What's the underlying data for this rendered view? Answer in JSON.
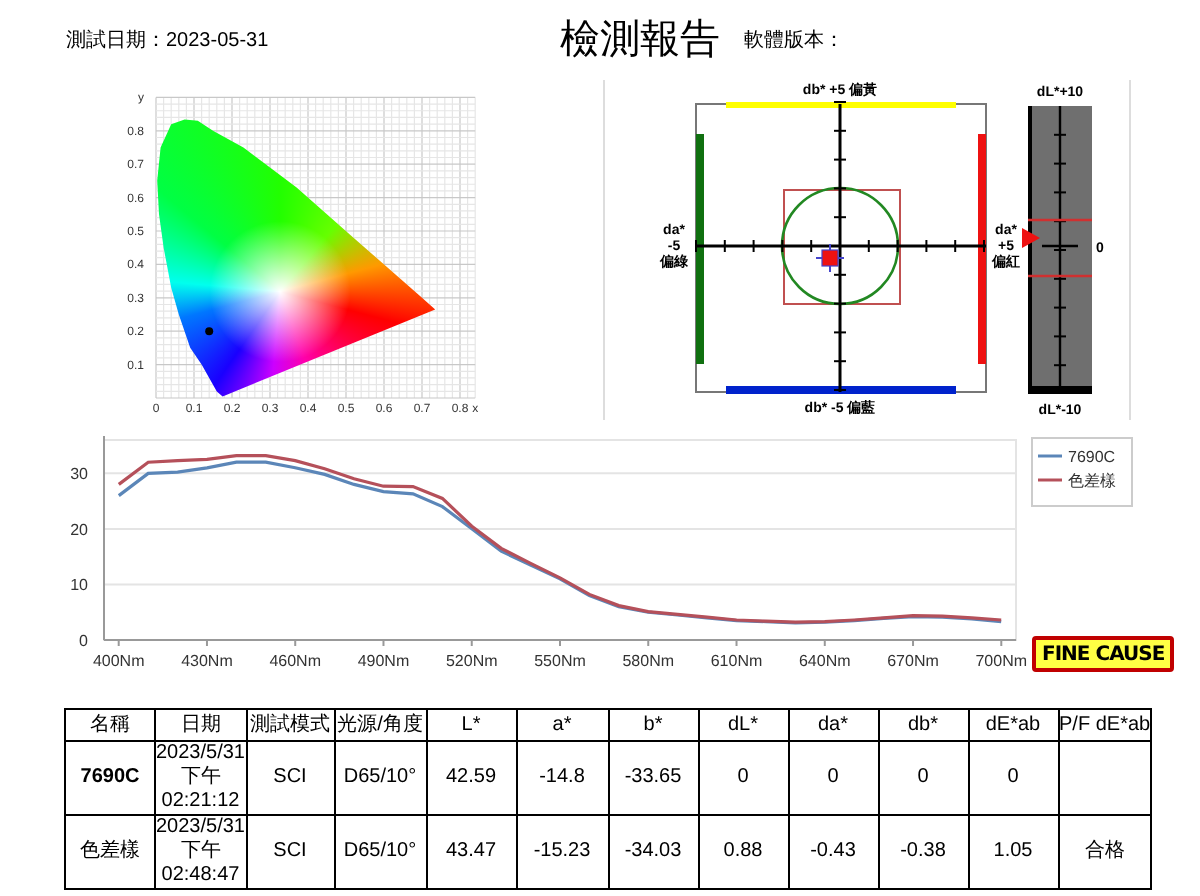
{
  "header": {
    "test_date": "測試日期：2023-05-31",
    "title": "檢測報告",
    "software_version": "軟體版本："
  },
  "chromaticity_diagram": {
    "chart_data": {
      "type": "scatter",
      "xlabel": "x",
      "ylabel": "y",
      "xlim": [
        0,
        0.8
      ],
      "ylim": [
        0,
        0.9
      ],
      "grid": true,
      "xticks": [
        0,
        0.1,
        0.2,
        0.3,
        0.4,
        0.5,
        0.6,
        0.7,
        0.8
      ],
      "yticks": [
        0.1,
        0.2,
        0.3,
        0.4,
        0.5,
        0.6,
        0.7,
        0.8
      ],
      "x": [
        0.14
      ],
      "series": [
        {
          "color": "#000000",
          "values": [
            0.2
          ]
        }
      ]
    }
  },
  "color_difference": {
    "top_label": "db* +5 偏黃",
    "bottom_label": "db* -5 偏藍",
    "left_label": [
      "da*",
      "-5",
      "偏綠"
    ],
    "right_label": [
      "da*",
      "+5",
      "偏紅"
    ],
    "lightness_bar": {
      "top_label": "dL*+10",
      "bottom_label": "dL*-10",
      "zero_label": "0"
    }
  },
  "spectrum": {
    "chart_data": {
      "type": "line",
      "x": [
        400,
        410,
        420,
        430,
        440,
        450,
        460,
        470,
        480,
        490,
        500,
        510,
        520,
        530,
        540,
        550,
        560,
        570,
        580,
        590,
        600,
        610,
        620,
        630,
        640,
        650,
        660,
        670,
        680,
        690,
        700
      ],
      "xticks": [
        {
          "value": 400,
          "label": "400Nm"
        },
        {
          "value": 430,
          "label": "430Nm"
        },
        {
          "value": 460,
          "label": "460Nm"
        },
        {
          "value": 490,
          "label": "490Nm"
        },
        {
          "value": 520,
          "label": "520Nm"
        },
        {
          "value": 550,
          "label": "550Nm"
        },
        {
          "value": 580,
          "label": "580Nm"
        },
        {
          "value": 610,
          "label": "610Nm"
        },
        {
          "value": 640,
          "label": "640Nm"
        },
        {
          "value": 670,
          "label": "670Nm"
        },
        {
          "value": 700,
          "label": "700Nm"
        }
      ],
      "xlim": [
        395,
        705
      ],
      "yticks": [
        0,
        10,
        20,
        30
      ],
      "ylim": [
        0,
        36
      ],
      "grid": true,
      "legend": true,
      "series": [
        {
          "name": "7690C",
          "color": "#5b86b8",
          "values": [
            26,
            30,
            30.2,
            31,
            32,
            32,
            31,
            29.8,
            28,
            26.7,
            26.3,
            24,
            20,
            16,
            13.5,
            11,
            8,
            6,
            5,
            4.5,
            4,
            3.5,
            3.3,
            3.1,
            3.2,
            3.5,
            3.9,
            4.2,
            4.1,
            3.8,
            3.3
          ]
        },
        {
          "name": "色差樣",
          "color": "#b5505a",
          "values": [
            28,
            32,
            32.3,
            32.5,
            33.2,
            33.2,
            32.3,
            30.8,
            29,
            27.7,
            27.6,
            25.5,
            20.5,
            16.5,
            13.8,
            11.2,
            8.2,
            6.2,
            5.1,
            4.6,
            4.1,
            3.6,
            3.4,
            3.2,
            3.3,
            3.6,
            4,
            4.4,
            4.3,
            4,
            3.6
          ]
        }
      ]
    },
    "badge": "FINE CAUSE"
  },
  "table": {
    "columns": [
      "名稱",
      "日期",
      "測試模式",
      "光源/角度",
      "L*",
      "a*",
      "b*",
      "dL*",
      "da*",
      "db*",
      "dE*ab",
      "P/F dE*ab"
    ],
    "rows": [
      {
        "kind": "standard",
        "cells": [
          "7690C",
          [
            "2023/5/31",
            "下午",
            "02:21:12"
          ],
          "SCI",
          "D65/10°",
          "42.59",
          "-14.8",
          "-33.65",
          "0",
          "0",
          "0",
          "0"
        ]
      },
      {
        "kind": "sample",
        "cells": [
          "色差樣",
          [
            "2023/5/31",
            "下午",
            "02:48:47"
          ],
          "SCI",
          "D65/10°",
          "43.47",
          "-15.23",
          "-34.03",
          "0.88",
          "-0.43",
          "-0.38",
          "1.05",
          "合格"
        ]
      }
    ]
  }
}
